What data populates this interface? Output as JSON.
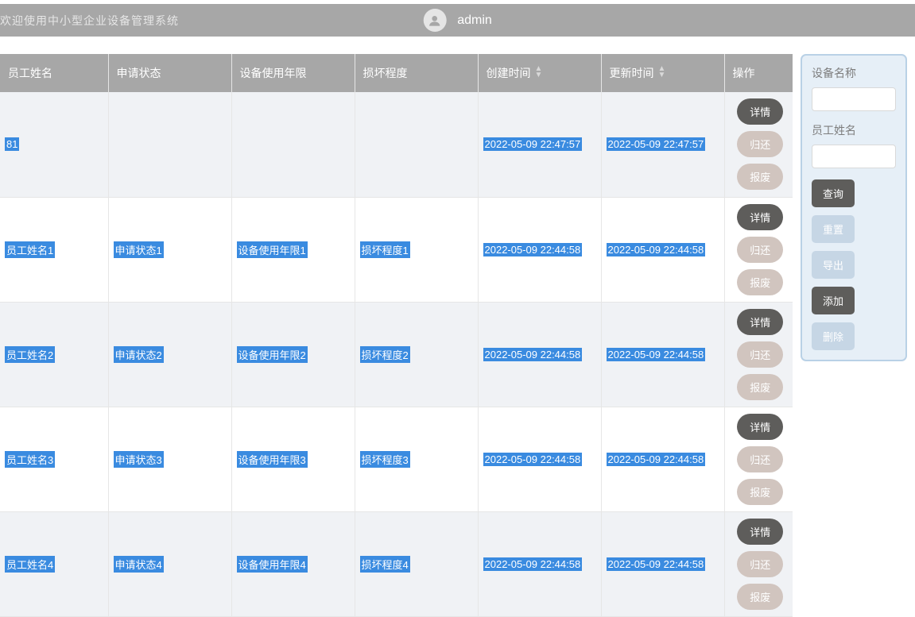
{
  "header": {
    "welcome": "欢迎使用中小型企业设备管理系统",
    "username": "admin"
  },
  "table": {
    "columns": {
      "employee": "员工姓名",
      "apply_status": "申请状态",
      "usage_year": "设备使用年限",
      "damage": "损坏程度",
      "create_time": "创建时间",
      "update_time": "更新时间",
      "ops": "操作"
    },
    "rows": [
      {
        "employee": "81",
        "apply_status": "",
        "usage_year": "",
        "damage": "",
        "create_time": "2022-05-09 22:47:57",
        "update_time": "2022-05-09 22:47:57"
      },
      {
        "employee": "员工姓名1",
        "apply_status": "申请状态1",
        "usage_year": "设备使用年限1",
        "damage": "损坏程度1",
        "create_time": "2022-05-09 22:44:58",
        "update_time": "2022-05-09 22:44:58"
      },
      {
        "employee": "员工姓名2",
        "apply_status": "申请状态2",
        "usage_year": "设备使用年限2",
        "damage": "损坏程度2",
        "create_time": "2022-05-09 22:44:58",
        "update_time": "2022-05-09 22:44:58"
      },
      {
        "employee": "员工姓名3",
        "apply_status": "申请状态3",
        "usage_year": "设备使用年限3",
        "damage": "损坏程度3",
        "create_time": "2022-05-09 22:44:58",
        "update_time": "2022-05-09 22:44:58"
      },
      {
        "employee": "员工姓名4",
        "apply_status": "申请状态4",
        "usage_year": "设备使用年限4",
        "damage": "损坏程度4",
        "create_time": "2022-05-09 22:44:58",
        "update_time": "2022-05-09 22:44:58"
      }
    ],
    "actions": {
      "detail": "详情",
      "return": "归还",
      "scrap": "报废"
    }
  },
  "filter": {
    "device_label": "设备名称",
    "employee_label": "员工姓名",
    "btns": {
      "query": "查询",
      "reset": "重置",
      "export_": "导出",
      "add": "添加",
      "delete_": "删除"
    }
  }
}
